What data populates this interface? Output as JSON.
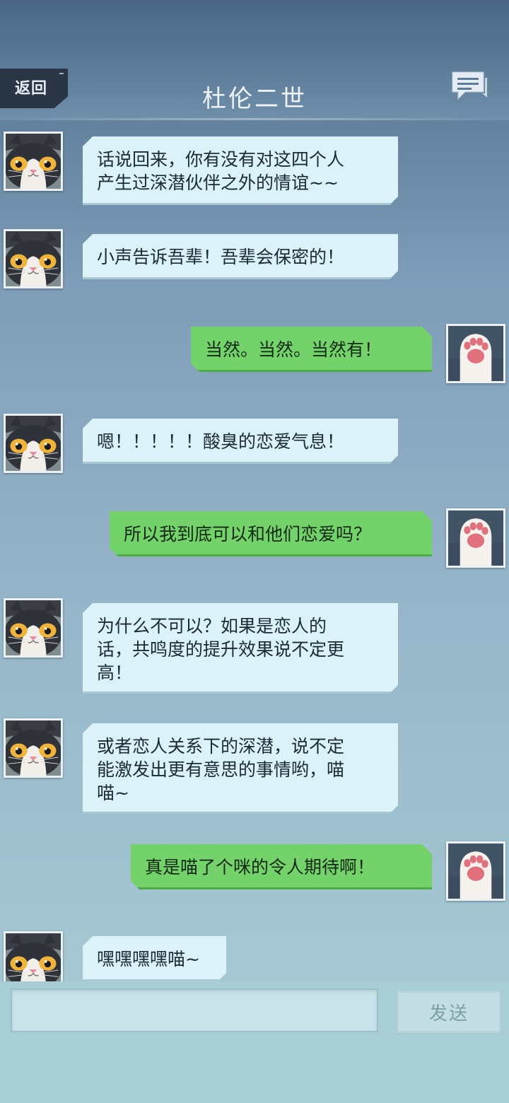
{
  "header": {
    "back_label": "返回",
    "title": "杜伦二世"
  },
  "messages": [
    {
      "side": "left",
      "text": "话说回来，你有没有对这四个人\n产生过深潜伙伴之外的情谊~~"
    },
    {
      "side": "left",
      "text": "小声告诉吾辈！吾辈会保密的！"
    },
    {
      "side": "right",
      "text": "当然。当然。当然有！"
    },
    {
      "side": "left",
      "text": "嗯！！！！！酸臭的恋爱气息！"
    },
    {
      "side": "right",
      "text": "所以我到底可以和他们恋爱吗？"
    },
    {
      "side": "left",
      "text": "为什么不可以？如果是恋人的\n话，共鸣度的提升效果说不定更\n高！"
    },
    {
      "side": "left",
      "text": "或者恋人关系下的深潜，说不定\n能激发出更有意思的事情哟，喵\n喵~"
    },
    {
      "side": "right",
      "text": "真是喵了个咪的令人期待啊！"
    },
    {
      "side": "left",
      "text": "嘿嘿嘿嘿喵~"
    }
  ],
  "input": {
    "value": "",
    "send_label": "发送"
  },
  "colors": {
    "left_bubble": "#daf2f8",
    "right_bubble": "#73d26a",
    "header": "#4a6784"
  },
  "icons": {
    "left_avatar": "cat-face-avatar",
    "right_avatar": "cat-paw-avatar",
    "chat": "chat-bubble-icon"
  }
}
